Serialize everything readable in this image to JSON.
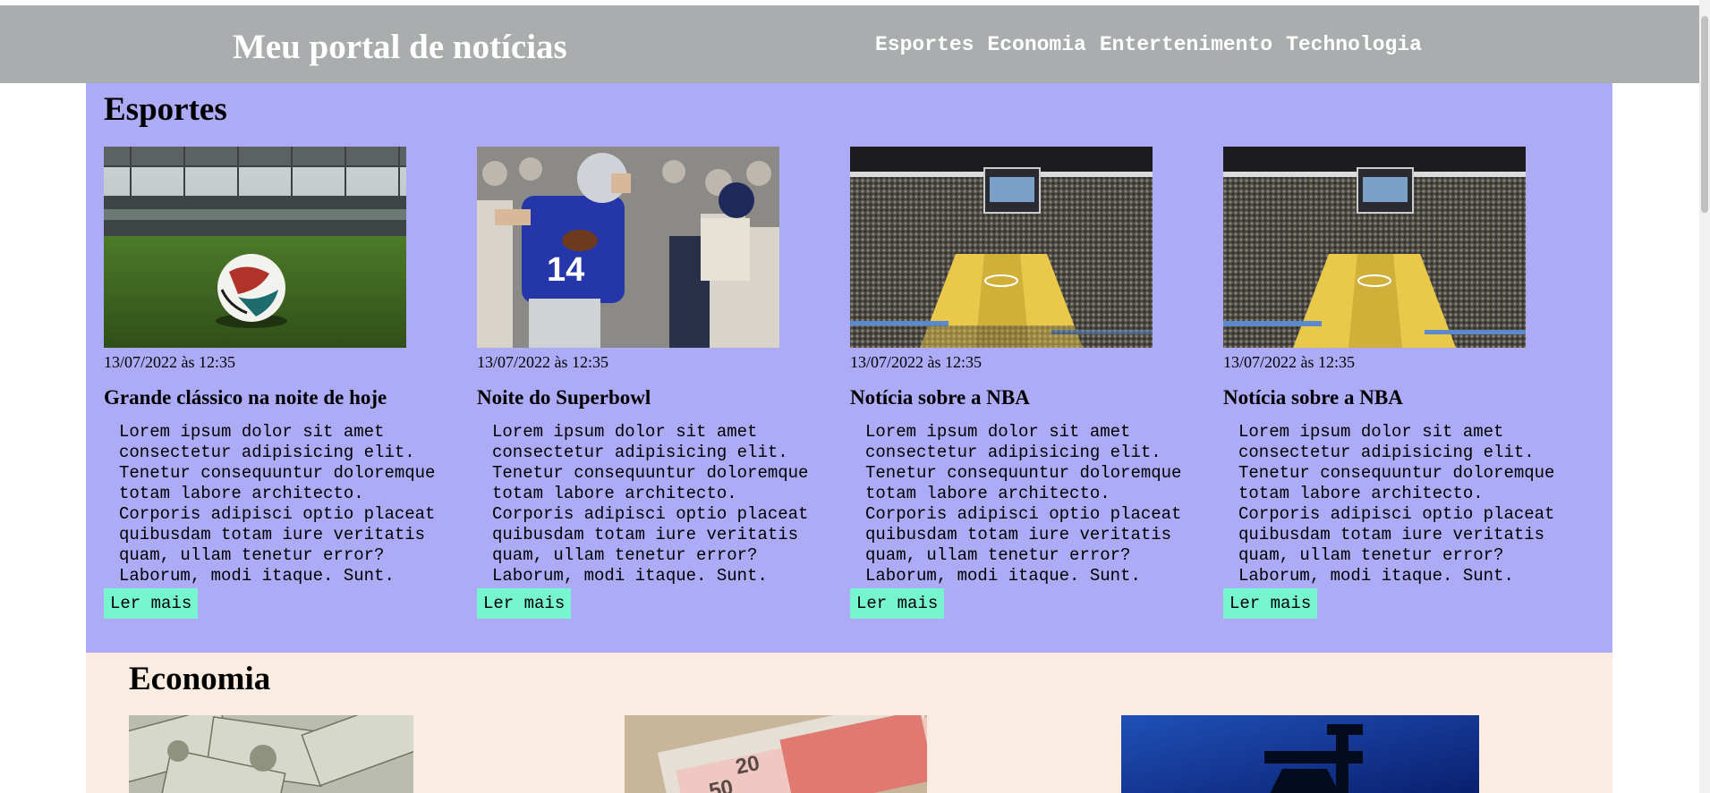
{
  "header": {
    "title": "Meu portal de notícias",
    "nav": [
      "Esportes",
      "Economia",
      "Entertenimento",
      "Technologia"
    ]
  },
  "sports": {
    "title": "Esportes",
    "cards": [
      {
        "image": "soccer-ball-stadium",
        "date": "13/07/2022 às 12:35",
        "title": "Grande clássico na noite de hoje",
        "excerpt": "Lorem ipsum dolor sit amet consectetur adipisicing elit. Tenetur consequuntur doloremque totam labore architecto. Corporis adipisci optio placeat quibusdam totam iure veritatis quam, ullam tenetur error? Laborum, modi itaque. Sunt.",
        "button": "Ler mais"
      },
      {
        "image": "football-quarterback",
        "date": "13/07/2022 às 12:35",
        "title": "Noite do Superbowl",
        "excerpt": "Lorem ipsum dolor sit amet consectetur adipisicing elit. Tenetur consequuntur doloremque totam labore architecto. Corporis adipisci optio placeat quibusdam totam iure veritatis quam, ullam tenetur error? Laborum, modi itaque. Sunt.",
        "button": "Ler mais"
      },
      {
        "image": "basketball-arena",
        "date": "13/07/2022 às 12:35",
        "title": "Notícia sobre a NBA",
        "excerpt": "Lorem ipsum dolor sit amet consectetur adipisicing elit. Tenetur consequuntur doloremque totam labore architecto. Corporis adipisci optio placeat quibusdam totam iure veritatis quam, ullam tenetur error? Laborum, modi itaque. Sunt.",
        "button": "Ler mais"
      },
      {
        "image": "basketball-arena",
        "date": "13/07/2022 às 12:35",
        "title": "Notícia sobre a NBA",
        "excerpt": "Lorem ipsum dolor sit amet consectetur adipisicing elit. Tenetur consequuntur doloremque totam labore architecto. Corporis adipisci optio placeat quibusdam totam iure veritatis quam, ullam tenetur error? Laborum, modi itaque. Sunt.",
        "button": "Ler mais"
      }
    ]
  },
  "economy": {
    "title": "Economia",
    "images": [
      "dollar-bills",
      "euro-notes",
      "oil-pump"
    ]
  },
  "colors": {
    "header_bg": "#a9adad",
    "sports_bg": "#adabf5",
    "economy_bg": "#faece0",
    "button_bg": "#77f5cf"
  }
}
